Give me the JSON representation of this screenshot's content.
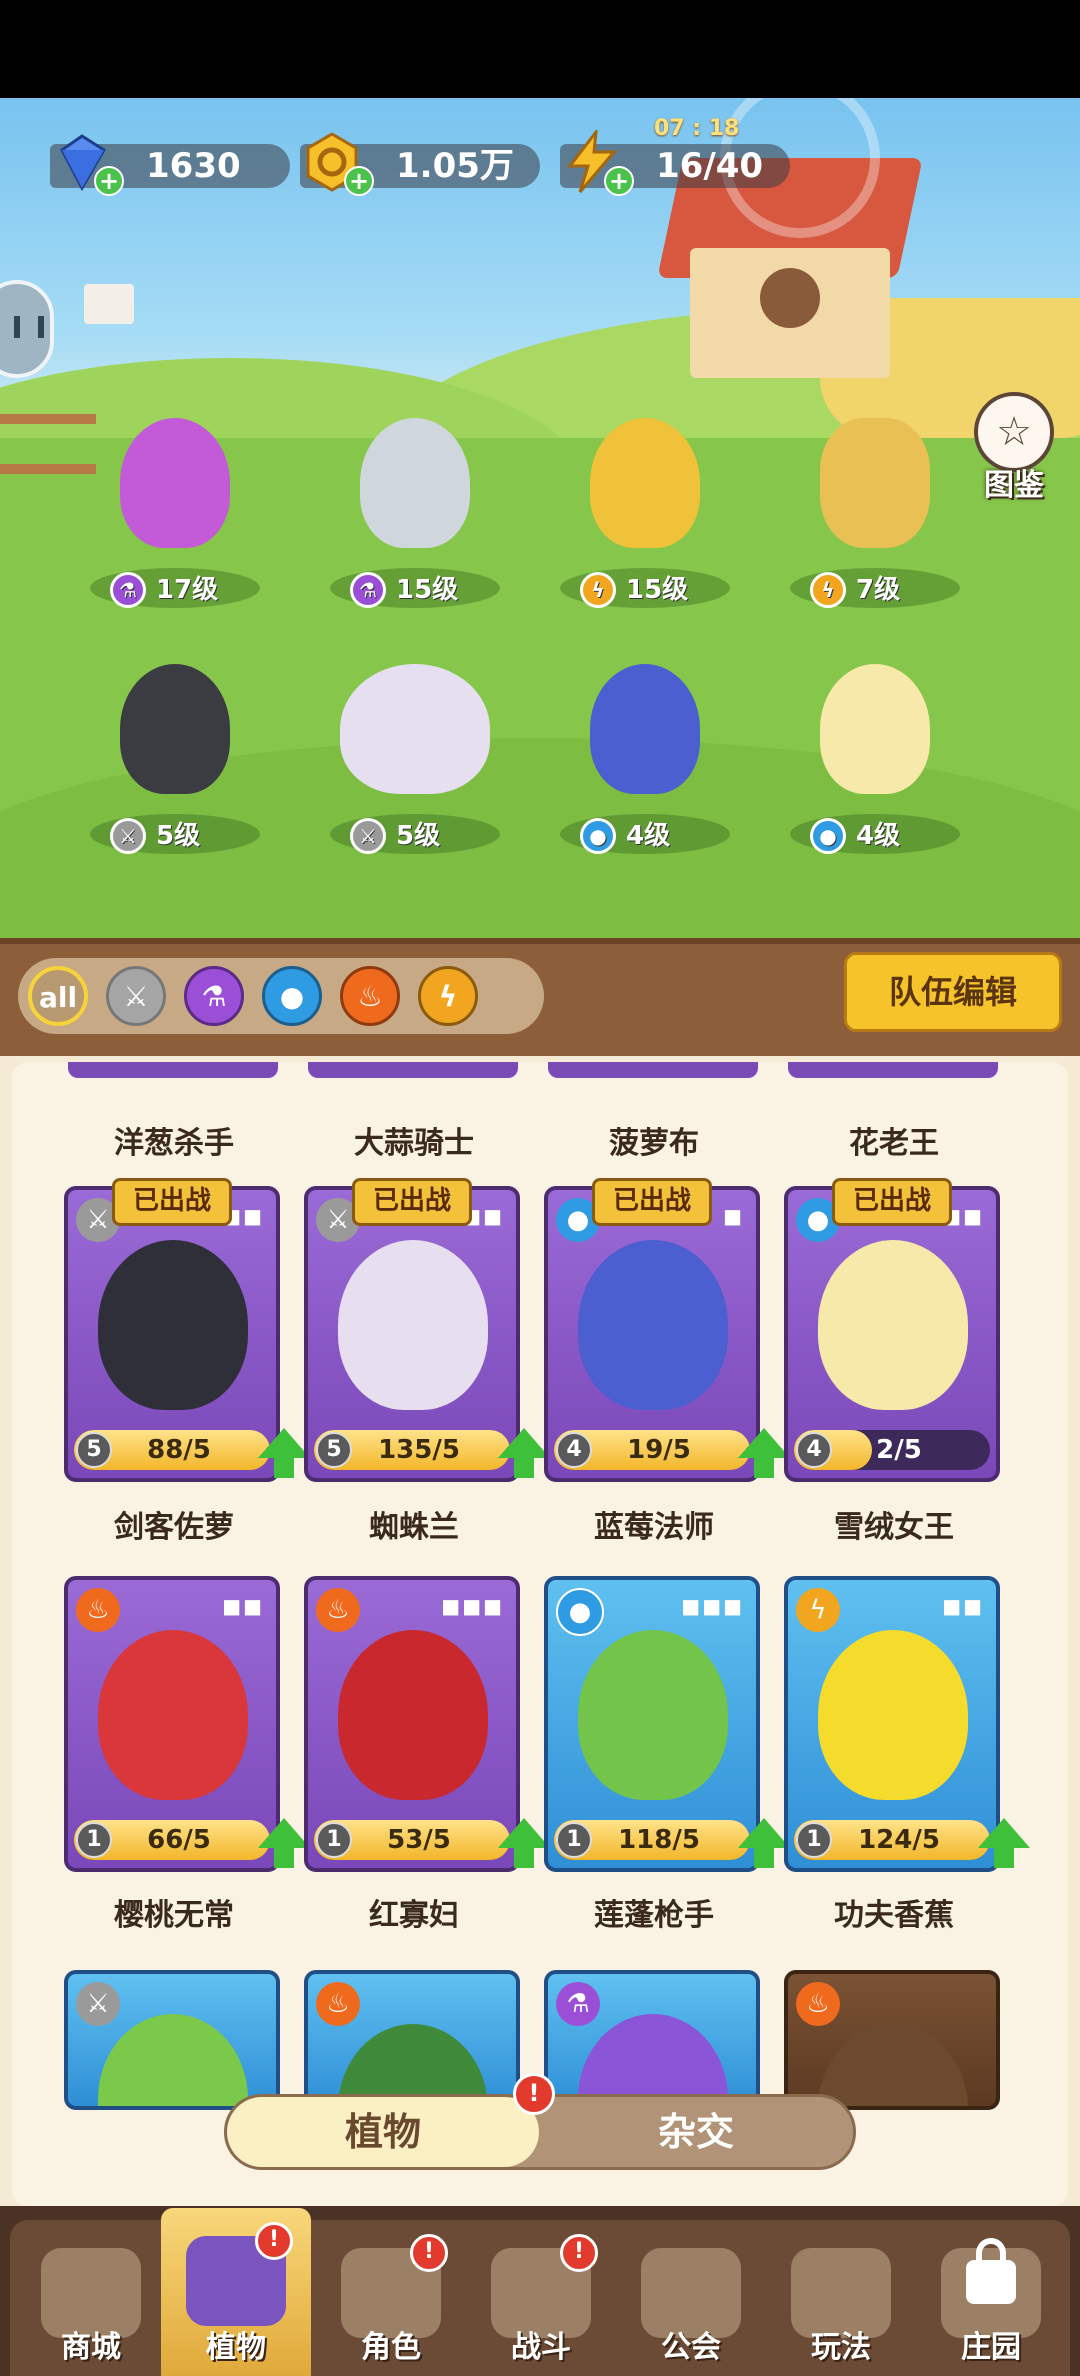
{
  "resources": {
    "gems": "1630",
    "coins": "1.05万",
    "energy": "16/40",
    "energy_timer": "07 : 18"
  },
  "codex_label": "图鉴",
  "team_chars": [
    {
      "level": "17级",
      "element": "poison"
    },
    {
      "level": "15级",
      "element": "poison"
    },
    {
      "level": "15级",
      "element": "electric"
    },
    {
      "level": "7级",
      "element": "electric"
    },
    {
      "level": "5级",
      "element": "sword"
    },
    {
      "level": "5级",
      "element": "sword"
    },
    {
      "level": "4级",
      "element": "water"
    },
    {
      "level": "4级",
      "element": "water"
    }
  ],
  "filters": [
    {
      "label": "all",
      "icon": "all-filter-icon"
    },
    {
      "label": "",
      "icon": "sword-icon"
    },
    {
      "label": "",
      "icon": "poison-flask-icon"
    },
    {
      "label": "",
      "icon": "water-drop-icon"
    },
    {
      "label": "",
      "icon": "fire-icon"
    },
    {
      "label": "",
      "icon": "lightning-icon"
    }
  ],
  "team_edit_label": "队伍编辑",
  "top_row_names": [
    "洋葱杀手",
    "大蒜骑士",
    "菠萝布",
    "花老王"
  ],
  "cards_row1": [
    {
      "name": "剑客佐萝",
      "level": "5",
      "progress": "88/5",
      "deployed": "已出战",
      "element": "sword",
      "upgradable": true
    },
    {
      "name": "蜘蛛兰",
      "level": "5",
      "progress": "135/5",
      "deployed": "已出战",
      "element": "sword",
      "upgradable": true
    },
    {
      "name": "蓝莓法师",
      "level": "4",
      "progress": "19/5",
      "deployed": "已出战",
      "element": "water",
      "upgradable": true
    },
    {
      "name": "雪绒女王",
      "level": "4",
      "progress": "2/5",
      "deployed": "已出战",
      "element": "water",
      "upgradable": false
    }
  ],
  "cards_row2": [
    {
      "name": "樱桃无常",
      "level": "1",
      "progress": "66/5",
      "element": "fire",
      "upgradable": true
    },
    {
      "name": "红寡妇",
      "level": "1",
      "progress": "53/5",
      "element": "fire",
      "upgradable": true
    },
    {
      "name": "莲蓬枪手",
      "level": "1",
      "progress": "118/5",
      "element": "water",
      "upgradable": true
    },
    {
      "name": "功夫香蕉",
      "level": "1",
      "progress": "124/5",
      "element": "electric",
      "upgradable": true
    }
  ],
  "toggle": {
    "plants": "植物",
    "hybrid": "杂交",
    "badge": "!"
  },
  "nav": [
    {
      "label": "商城",
      "badge": ""
    },
    {
      "label": "植物",
      "badge": "!"
    },
    {
      "label": "角色",
      "badge": "!"
    },
    {
      "label": "战斗",
      "badge": "!"
    },
    {
      "label": "公会",
      "badge": ""
    },
    {
      "label": "玩法",
      "badge": ""
    },
    {
      "label": "庄园",
      "badge": ""
    }
  ],
  "colors": {
    "poison": "#9b4fd6",
    "electric": "#f2a51e",
    "sword": "#9a9a9a",
    "water": "#2f9be3",
    "fire": "#ef6a1c",
    "accent": "#f7c32a"
  }
}
